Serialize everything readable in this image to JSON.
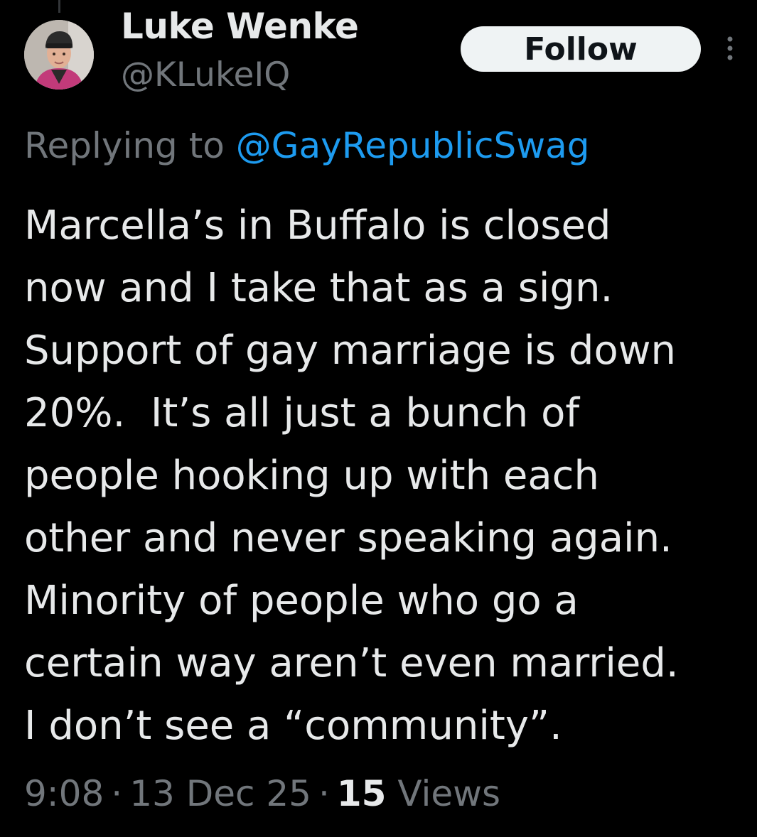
{
  "tweet": {
    "author": {
      "display_name": "Luke Wenke",
      "handle": "@KLukeIQ",
      "avatar_icon": "profile-photo"
    },
    "follow_label": "Follow",
    "more_icon": "more-vertical-icon",
    "replying": {
      "prefix": "Replying to ",
      "target": "@GayRepublicSwag"
    },
    "text_lines": [
      "Marcella’s in Buffalo is closed",
      "now and I take that as a sign.",
      "Support of gay marriage is down",
      "20%.  It’s all just a bunch of",
      "people hooking up with each",
      "other and never speaking again.",
      "Minority of people who go a",
      "certain way aren’t even married.",
      "I don’t see a “community”."
    ],
    "meta": {
      "time": "9:08",
      "date": "13 Dec 25",
      "separator": "·",
      "views_count": "15",
      "views_label": "Views"
    }
  },
  "colors": {
    "background": "#000000",
    "primary_text": "#e7e9ea",
    "secondary_text": "#71767b",
    "link": "#1d9bf0",
    "follow_bg": "#eff3f4",
    "follow_text": "#0f1419"
  }
}
